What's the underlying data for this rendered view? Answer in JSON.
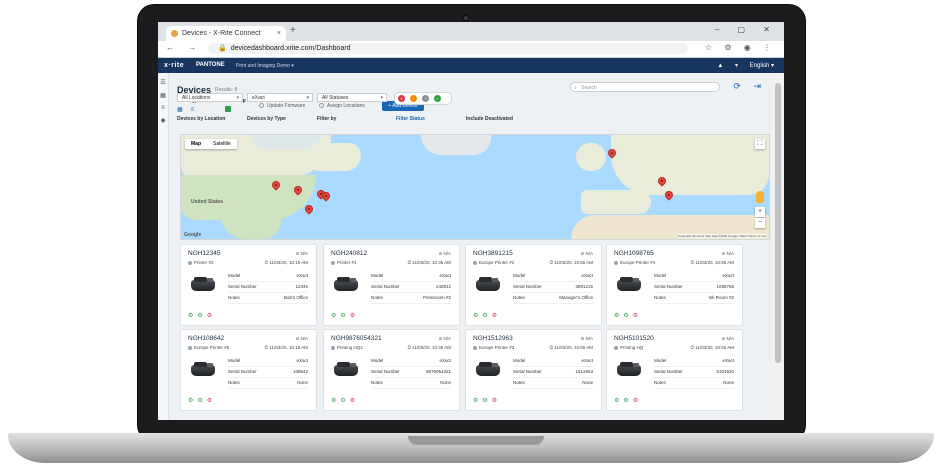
{
  "browser": {
    "tab_title": "Devices - X-Rite Connect",
    "tab_close": "×",
    "new_tab": "+",
    "window_controls": "–  ▢  ✕",
    "nav_buttons": "←  →  ↻",
    "url": "devicedashboard.xrite.com/Dashboard",
    "url_lock": "🔒",
    "toolbar_icons": "☆ ⚙ ◉ ⋮"
  },
  "app_header": {
    "logo": "x·rite",
    "logo2": "PANTONE",
    "app_name": "Print and Imaging Demo ▾",
    "user_icon": "▲",
    "language_caret": "▾",
    "language": "English ▾"
  },
  "sidebar": {
    "items": [
      "☰",
      "▦",
      "≡",
      "◉"
    ]
  },
  "page": {
    "title": "Devices",
    "results": "Results: 8",
    "search_placeholder": "Search",
    "search_icon": "⌕",
    "top_icons": "⟳ ⇥",
    "view_type_label": "View Type",
    "view_icons": "▦ ≡",
    "show_map_label": "Show Map",
    "update_firmware": "Update Firmware",
    "assign_locations": "Assign Locations",
    "add_device": "+ Add Device",
    "devices_by_location_label": "Devices by Location",
    "devices_by_location_value": "All Locations",
    "devices_by_type_label": "Devices by Type",
    "devices_by_type_value": "eXact",
    "filter_by_label": "Filter by",
    "filter_by_value": "All Statuses",
    "filter_status_label": "Filter Status",
    "filter_status_dots": [
      {
        "glyph": "✕",
        "color": "#e03131"
      },
      {
        "glyph": "!",
        "color": "#f08c00"
      },
      {
        "glyph": "?",
        "color": "#868e96"
      },
      {
        "glyph": "✓",
        "color": "#2f9e44"
      }
    ],
    "include_deactivated_label": "Include Deactivated"
  },
  "map": {
    "tab_map": "Map",
    "tab_satellite": "Satellite",
    "label_us": "United States",
    "google": "Google",
    "attribution": "Keyboard shortcuts  Map data ©2020 Google, INEGI  Terms of Use",
    "fullscreen": "⛶",
    "zoom_in": "+",
    "zoom_out": "−"
  },
  "devices": [
    {
      "serial": "NGH12345",
      "status": "N/A",
      "name": "Printer #2",
      "date": "11/03/20, 10:15 AM",
      "model": "eXact",
      "serial_number": "12345",
      "notes": "Bob's Office"
    },
    {
      "serial": "NGH240812",
      "status": "N/A",
      "name": "Printer #1",
      "date": "11/03/20, 10:35 AM",
      "model": "eXact",
      "serial_number": "240812",
      "notes": "Pressroom #2"
    },
    {
      "serial": "NGH3891215",
      "status": "N/A",
      "name": "Europe Printer #2",
      "date": "11/03/20, 10:55 AM",
      "model": "eXact",
      "serial_number": "3891215",
      "notes": "Manager's Office"
    },
    {
      "serial": "NGH1098765",
      "status": "N/A",
      "name": "Europe Printer #4",
      "date": "11/03/20, 10:55 AM",
      "model": "eXact",
      "serial_number": "1098765",
      "notes": "Ink Room #2"
    },
    {
      "serial": "NGH108642",
      "status": "N/A",
      "name": "Europe Printer #5",
      "date": "11/03/20, 10:15 AM",
      "model": "eXact",
      "serial_number": "108642",
      "notes": "None"
    },
    {
      "serial": "NGH9876054321",
      "status": "N/A",
      "name": "Printing HQ2",
      "date": "11/03/20, 10:35 AM",
      "model": "eXact",
      "serial_number": "9876054321",
      "notes": "None"
    },
    {
      "serial": "NGH1512963",
      "status": "N/A",
      "name": "Europe Printer #3",
      "date": "11/03/20, 10:55 AM",
      "model": "eXact",
      "serial_number": "1512963",
      "notes": "None"
    },
    {
      "serial": "NGH5101520",
      "status": "N/A",
      "name": "Printing HQ",
      "date": "11/03/20, 10:55 AM",
      "model": "eXact",
      "serial_number": "5101520",
      "notes": "None"
    }
  ],
  "card_labels": {
    "model": "Model",
    "serial_number": "Serial Number",
    "notes": "Notes",
    "status_icon": "⊘",
    "date_icon": "⏱"
  },
  "card_actions": [
    "⚙",
    "⚙",
    "⚙"
  ]
}
